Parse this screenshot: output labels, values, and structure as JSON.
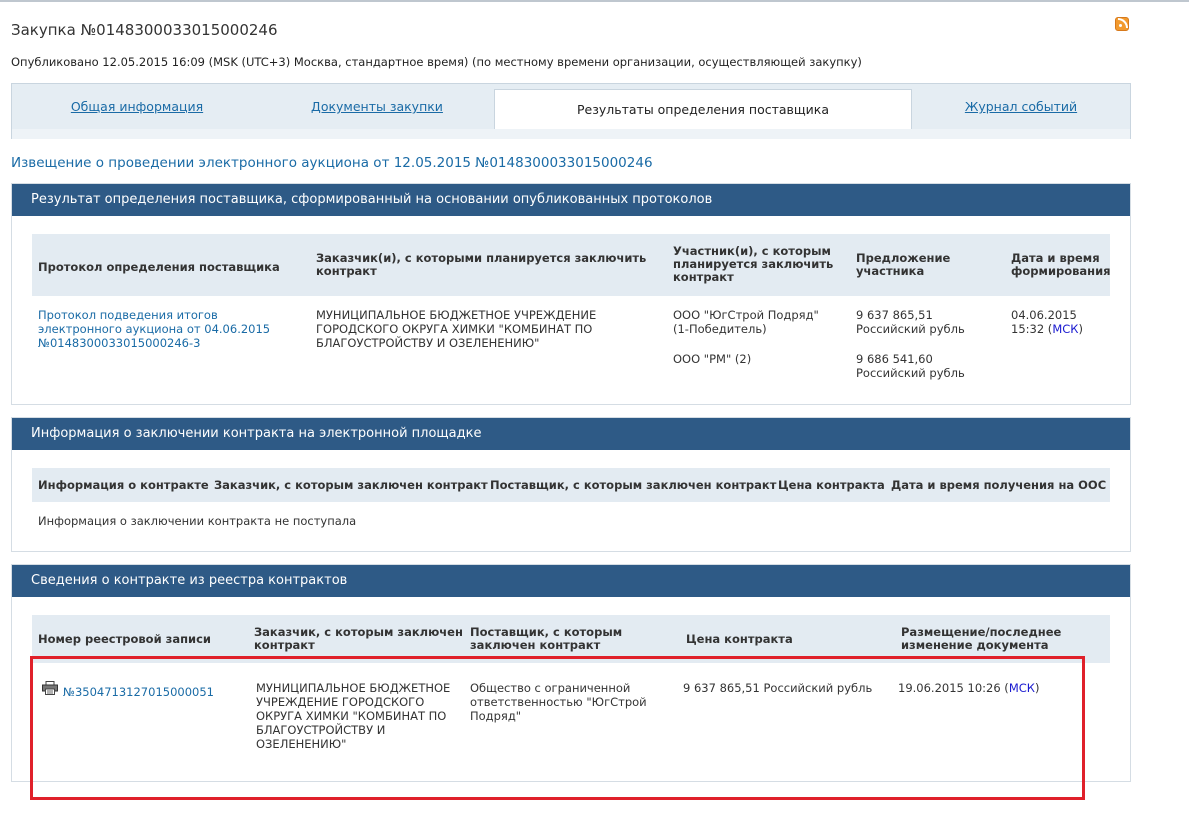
{
  "header": {
    "title": "Закупка №0148300033015000246",
    "published": "Опубликовано 12.05.2015 16:09 (MSK (UTC+3) Москва, стандартное время) (по местному времени организации, осуществляющей закупку)"
  },
  "tabs": [
    {
      "label": "Общая информация",
      "active": false
    },
    {
      "label": "Документы закупки",
      "active": false
    },
    {
      "label": "Результаты определения поставщика",
      "active": true
    },
    {
      "label": "Журнал событий",
      "active": false
    }
  ],
  "notice_link": "Извещение о проведении электронного аукциона от 12.05.2015 №0148300033015000246",
  "section1": {
    "title": "Результат определения поставщика, сформированный на основании опубликованных протоколов",
    "columns": [
      "Протокол определения поставщика",
      "Заказчик(и), с которыми планируется заключить контракт",
      "Участник(и), с которым планируется заключить контракт",
      "Предложение участника",
      "Дата и время формирования"
    ],
    "protocol_link": "Протокол подведения итогов электронного аукциона от 04.06.2015 №0148300033015000246-3",
    "customer": "МУНИЦИПАЛЬНОЕ БЮДЖЕТНОЕ УЧРЕЖДЕНИЕ ГОРОДСКОГО ОКРУГА ХИМКИ \"КОМБИНАТ ПО БЛАГОУСТРОЙСТВУ И ОЗЕЛЕНЕНИЮ\"",
    "participants": [
      {
        "name": "ООО \"ЮгСтрой Подряд\" (1-Победитель)",
        "offer": "9 637 865,51 Российский рубль"
      },
      {
        "name": "ООО \"РМ\" (2)",
        "offer": "9 686 541,60 Российский рубль"
      }
    ],
    "date": "04.06.2015 15:32",
    "tz": "МСК"
  },
  "section2": {
    "title": "Информация о заключении контракта на электронной площадке",
    "columns": [
      "Информация о контракте",
      "Заказчик, с которым заключен контракт",
      "Поставщик, с которым заключен контракт",
      "Цена контракта",
      "Дата и время получения на ООС"
    ],
    "empty_message": "Информация о заключении контракта не поступала"
  },
  "section3": {
    "title": "Сведения о контракте из реестра контрактов",
    "columns": [
      "Номер реестровой записи",
      "Заказчик, с которым заключен контракт",
      "Поставщик, с которым заключен контракт",
      "Цена контракта",
      "Размещение/последнее изменение документа"
    ],
    "row": {
      "registry_number": "№3504713127015000051",
      "customer": "МУНИЦИПАЛЬНОЕ БЮДЖЕТНОЕ УЧРЕЖДЕНИЕ ГОРОДСКОГО ОКРУГА ХИМКИ \"КОМБИНАТ ПО БЛАГОУСТРОЙСТВУ И ОЗЕЛЕНЕНИЮ\"",
      "supplier": "Общество с ограниченной ответственностью \"ЮгСтрой Подряд\"",
      "price": "9 637 865,51 Российский рубль",
      "date": "19.06.2015 10:26",
      "tz": "МСК"
    }
  },
  "icons": {
    "rss": "rss-icon",
    "print": "printer-icon"
  },
  "colors": {
    "section_header": "#2e5a86",
    "link": "#1a6ba6",
    "highlight_box": "#e0202a"
  }
}
